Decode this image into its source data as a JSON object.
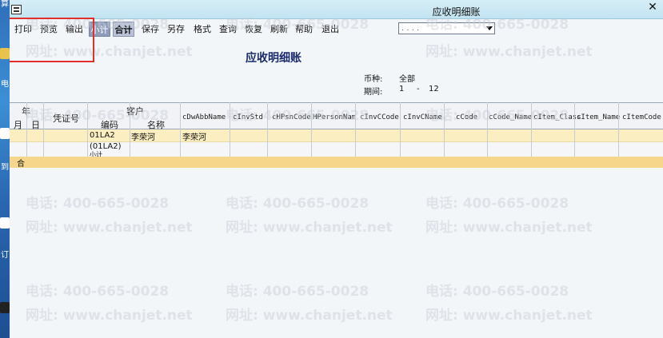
{
  "window": {
    "title": "应收明细账"
  },
  "toolbar": {
    "buttons": [
      "打印",
      "预览",
      "输出",
      "小计",
      "合计",
      "保存",
      "另存",
      "格式",
      "查询",
      "恢复",
      "刷新",
      "帮助",
      "退出"
    ],
    "dropdown_value": ". . . ."
  },
  "report": {
    "title": "应收明细账",
    "currency_label": "币种:",
    "currency_value": "全部",
    "period_label": "期间:",
    "period_from": "1",
    "period_sep": "-",
    "period_to": "12"
  },
  "table": {
    "header": {
      "year": "年",
      "month": "月",
      "day": "日",
      "voucher": "凭证号",
      "customer": "客户",
      "code": "编码",
      "name": "名称",
      "cols": [
        "cDwAbbName",
        "cInvStd",
        "cHPsnCode",
        "HPersonNam",
        "cInvCCode",
        "cInvCName",
        "cCode",
        "cCode_Name",
        "cItem_Class",
        "cItem_Name",
        "cItemCode"
      ]
    },
    "rows": [
      {
        "code": "01LA2",
        "name": "李荣河",
        "abbr": "李荣河"
      },
      {
        "code": "(01LA2)",
        "code2": "小计"
      }
    ],
    "total_label": "合"
  },
  "watermark": {
    "phone": "电话: 400-665-0028",
    "site": "网址: www.chanjet.net"
  },
  "desktop": {
    "glyphs": [
      "算",
      "电",
      "到",
      "订"
    ]
  }
}
